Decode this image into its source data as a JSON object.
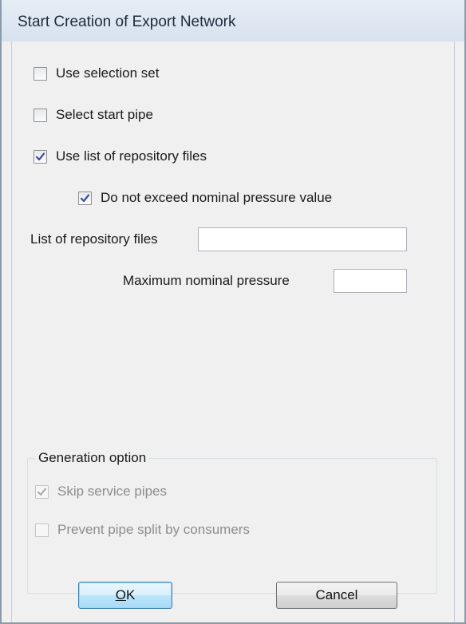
{
  "window": {
    "title": "Start Creation of Export Network"
  },
  "options": {
    "use_selection_set": {
      "label": "Use selection set",
      "checked": false
    },
    "select_start_pipe": {
      "label": "Select start pipe",
      "checked": false
    },
    "use_list_of_repository_files": {
      "label": "Use list of repository files",
      "checked": true
    },
    "do_not_exceed_pressure": {
      "label": "Do not exceed nominal pressure value",
      "checked": true
    }
  },
  "fields": {
    "repository_files": {
      "label": "List of repository files",
      "value": ""
    },
    "max_nominal_pressure": {
      "label": "Maximum nominal pressure",
      "value": ""
    }
  },
  "generation": {
    "legend": "Generation option",
    "skip_service_pipes": {
      "label": "Skip service pipes",
      "checked": true,
      "enabled": false
    },
    "prevent_pipe_split": {
      "label": "Prevent pipe split by consumers",
      "checked": false,
      "enabled": false
    }
  },
  "buttons": {
    "ok_mnemonic": "O",
    "ok_rest": "K",
    "cancel": "Cancel"
  },
  "colors": {
    "check_active": "#3a4f9e",
    "check_disabled": "#a9a9a9"
  },
  "icons": {
    "checkmark": "checkmark-icon"
  }
}
